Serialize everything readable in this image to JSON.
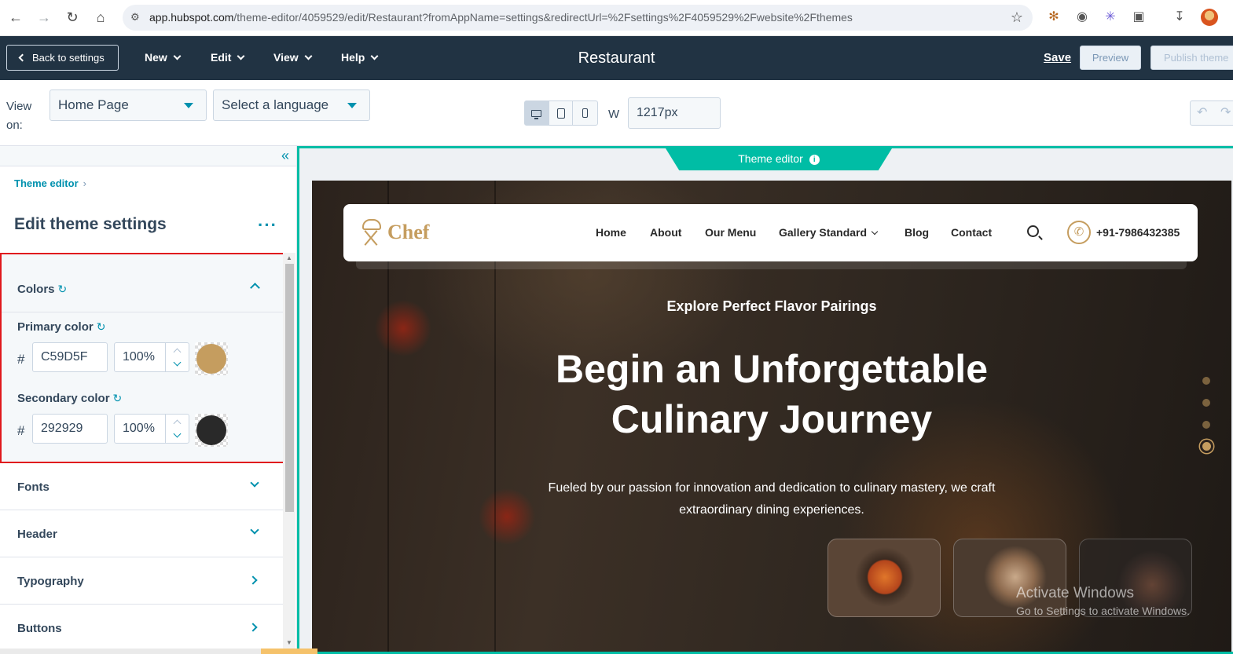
{
  "browser": {
    "url_host": "app.hubspot.com",
    "url_path": "/theme-editor/4059529/edit/Restaurant?fromAppName=settings&redirectUrl=%2Fsettings%2F4059529%2Fwebsite%2Fthemes"
  },
  "header": {
    "back_label": "Back to settings",
    "menus": [
      "New",
      "Edit",
      "View",
      "Help"
    ],
    "title": "Restaurant",
    "save_label": "Save",
    "preview_label": "Preview",
    "publish_label": "Publish theme"
  },
  "toolbar": {
    "view_on_label": "View on:",
    "page_select": "Home Page",
    "language_select": "Select a language",
    "width_label": "W",
    "width_value": "1217px",
    "active_device": "desktop"
  },
  "sidebar": {
    "breadcrumb": "Theme editor",
    "title": "Edit theme settings",
    "colors_section": {
      "label": "Colors",
      "expanded": true,
      "primary": {
        "label": "Primary color",
        "hex": "C59D5F",
        "opacity": "100%",
        "swatch": "#C59D5F"
      },
      "secondary": {
        "label": "Secondary color",
        "hex": "292929",
        "opacity": "100%",
        "swatch": "#292929"
      }
    },
    "sections": [
      {
        "label": "Fonts",
        "chevron": "down"
      },
      {
        "label": "Header",
        "chevron": "down"
      },
      {
        "label": "Typography",
        "chevron": "right"
      },
      {
        "label": "Buttons",
        "chevron": "right"
      }
    ]
  },
  "preview": {
    "tab_label": "Theme editor",
    "site": {
      "logo_text": "Chef",
      "nav_links": [
        "Home",
        "About",
        "Our Menu",
        "Gallery Standard",
        "Blog",
        "Contact"
      ],
      "phone": "+91-7986432385",
      "hero_eyebrow": "Explore Perfect Flavor Pairings",
      "hero_title": "Begin an Unforgettable Culinary Journey",
      "hero_subtitle": "Fueled by our passion for innovation and dedication to culinary mastery, we craft extraordinary dining experiences."
    },
    "watermark": {
      "title": "Activate Windows",
      "subtitle": "Go to Settings to activate Windows."
    }
  },
  "colors": {
    "accent": "#0091ae",
    "header_bg": "#213343",
    "highlight_border": "#e0191d",
    "theme_teal": "#00bda5"
  }
}
